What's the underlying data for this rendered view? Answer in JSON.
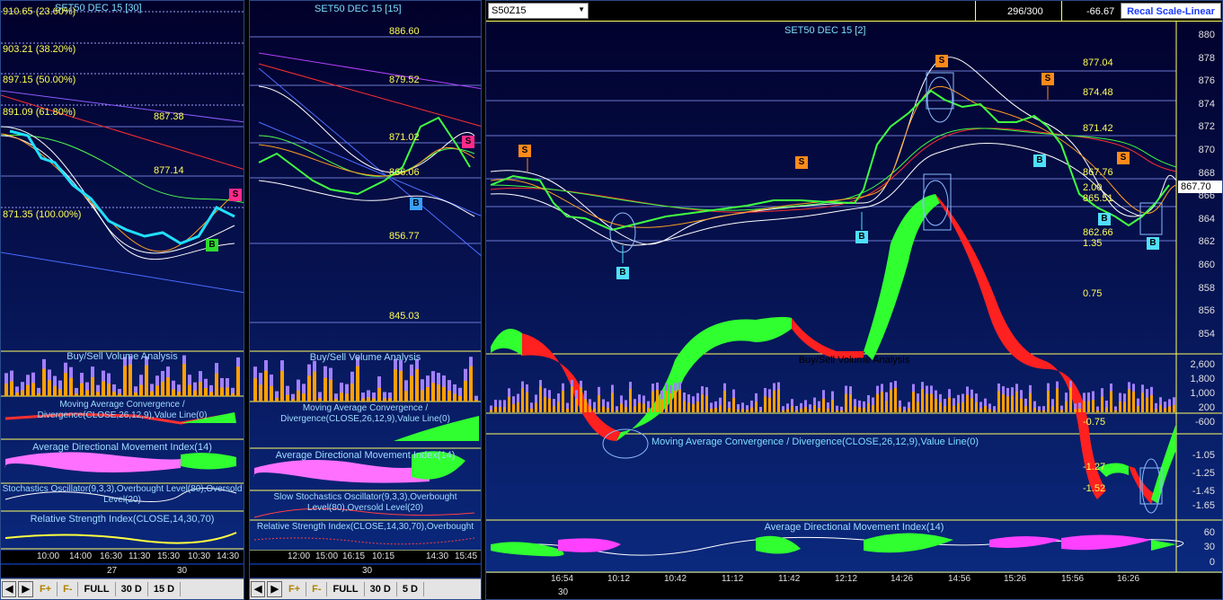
{
  "left": {
    "title": "SET50 DEC 15  [30]",
    "fib_labels": [
      "910.65 (23.60%)",
      "903.21 (38.20%)",
      "897.15 (50.00%)",
      "891.09 (61.80%)",
      "871.35 (100.00%)"
    ],
    "price_labels": [
      "887.38",
      "877.14"
    ],
    "markers": [
      "S",
      "B"
    ],
    "indicators": [
      "Buy/Sell Volume Analysis",
      "Moving Average Convergence / Divergence(CLOSE,26,12,9),Value Line(0)",
      "Average Directional Movement Index(14)",
      "Stochastics Oscillator(9,3,3),Overbought Level(80),Oversold Level(20)",
      "Relative Strength Index(CLOSE,14,30,70)"
    ],
    "times": [
      "10:00",
      "14:00",
      "16:30",
      "11:30",
      "15:30",
      "10:30",
      "14:30"
    ],
    "dates": [
      "27",
      "30"
    ],
    "toolbar": {
      "f_plus": "F+",
      "f_minus": "F-",
      "full": "FULL",
      "range1": "30 D",
      "range2": "15 D"
    }
  },
  "middle": {
    "title": "SET50 DEC 15   [15]",
    "price_labels": [
      "886.60",
      "879.52",
      "871.02",
      "866.06",
      "856.77",
      "845.03"
    ],
    "markers": [
      "S",
      "B"
    ],
    "indicators": [
      "Buy/Sell Volume Analysis",
      "Moving Average Convergence / Divergence(CLOSE,26,12,9),Value Line(0)",
      "Average Directional Movement Index(14)",
      "Slow Stochastics Oscillator(9,3,3),Overbought Level(80),Oversold Level(20)",
      "Relative Strength Index(CLOSE,14,30,70),Overbought"
    ],
    "times": [
      "12:00",
      "15:00",
      "16:15",
      "10:15",
      "14:30",
      "15:45"
    ],
    "dates": [
      "30"
    ],
    "toolbar": {
      "f_plus": "F+",
      "f_minus": "F-",
      "full": "FULL",
      "range1": "30 D",
      "range2": "5 D"
    }
  },
  "main": {
    "symbol": "S50Z15",
    "counter": "296/300",
    "change": "-66.67",
    "scale_button": "Recal Scale-Linear",
    "title": "SET50 DEC 15  [2]",
    "price_labels": [
      "877.04",
      "874.48",
      "871.42",
      "867.76",
      "865.51",
      "862.66"
    ],
    "current_price": "867.70",
    "osc_labels": [
      "2.00",
      "1.35",
      "0.75",
      "-0.75",
      "-1.27",
      "-1.52"
    ],
    "y_axis": [
      "880",
      "878",
      "876",
      "874",
      "872",
      "870",
      "868",
      "866",
      "864",
      "862",
      "860",
      "858",
      "856",
      "854"
    ],
    "vol_axis": [
      "2,600",
      "1,800",
      "1,000",
      "200",
      "-600"
    ],
    "macd_axis": [
      "-1.05",
      "-1.25",
      "-1.45",
      "-1.65"
    ],
    "adx_axis": [
      "60",
      "30",
      "0"
    ],
    "indicators": [
      "Buy/Sell Volume Analysis",
      "Moving Average Convergence / Divergence(CLOSE,26,12,9),Value Line(0)",
      "Average Directional Movement Index(14)"
    ],
    "times": [
      "16:54",
      "10:12",
      "10:42",
      "11:12",
      "11:42",
      "12:12",
      "14:26",
      "14:56",
      "15:26",
      "15:56",
      "16:26"
    ],
    "dates": [
      "30"
    ],
    "markers": [
      "S",
      "B",
      "S",
      "B",
      "S",
      "S",
      "B",
      "B",
      "S",
      "B"
    ]
  }
}
